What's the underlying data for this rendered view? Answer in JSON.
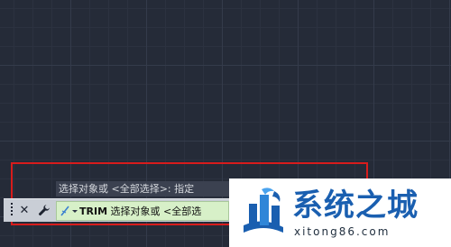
{
  "colors": {
    "canvas_background": "#252b38",
    "highlight_border": "#d81c1c",
    "command_input_bg": "#d7f0c8",
    "logo_blue": "#1a5fb0"
  },
  "command_history": {
    "text": "选择对象或 <全部选择>: 指定"
  },
  "command_line": {
    "close_icon": "close-icon",
    "settings_icon": "wrench-icon",
    "prompt_icon": "command-prompt-icon",
    "command_keyword": "TRIM",
    "prompt_text": " 选择对象或 <全部选"
  },
  "watermark": {
    "title": "系统之城",
    "url": "xitong86.com"
  }
}
